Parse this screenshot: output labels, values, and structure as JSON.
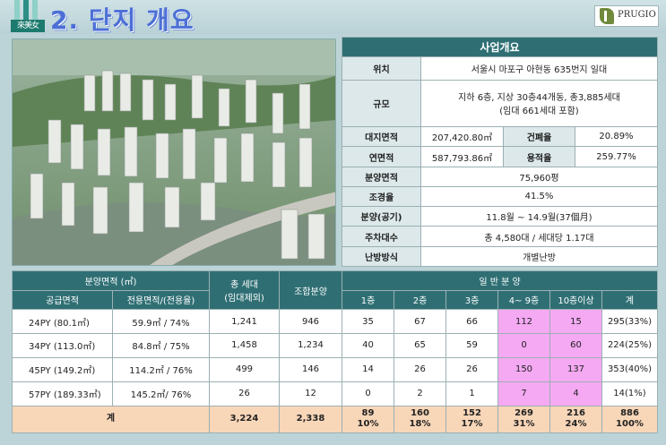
{
  "header": {
    "badge": "來美女",
    "title": "2. 단지 개요",
    "logo": "PRUGIO"
  },
  "info": {
    "heading": "사업개요",
    "rows": {
      "location": {
        "label": "위치",
        "value": "서울시 마포구 아현동 635번지 일대"
      },
      "scale": {
        "label": "규모",
        "line1": "지하 6층, 지상 30층44개동, 총3,885세대",
        "line2": "(임대 661세대 포함)"
      },
      "site": {
        "label": "대지면적",
        "value": "207,420.80㎡",
        "label2": "건폐율",
        "value2": "20.89%"
      },
      "floor": {
        "label": "연면적",
        "value": "587,793.86㎡",
        "label2": "용적율",
        "value2": "259.77%"
      },
      "sale_area": {
        "label": "분양면적",
        "value": "75,960평"
      },
      "landscape": {
        "label": "조경율",
        "value": "41.5%"
      },
      "schedule": {
        "label": "분양(공기)",
        "value": "11.8월 ~ 14.9월(37個月)"
      },
      "parking": {
        "label": "주차대수",
        "value": "총 4,580대 /  세대당 1.17대"
      },
      "heating": {
        "label": "난방방식",
        "value": "개별난방"
      }
    }
  },
  "table": {
    "h_area": "분양면적 (㎡)",
    "h_supply": "공급면적",
    "h_excl": "전용면적/(전용율)",
    "h_total_line1": "총 세대",
    "h_total_line2": "(임대제외)",
    "h_union": "조합분양",
    "h_general": "일 반 분 양",
    "h_floors": [
      "1층",
      "2층",
      "3층",
      "4~ 9층",
      "10층이상",
      "계"
    ],
    "rows": [
      {
        "supply": "24PY (80.1㎡)",
        "excl": "59.9㎡ / 74%",
        "total": "1,241",
        "union": "946",
        "f": [
          "35",
          "67",
          "66",
          "112",
          "15",
          "295(33%)"
        ]
      },
      {
        "supply": "34PY (113.0㎡)",
        "excl": "84.8㎡ / 75%",
        "total": "1,458",
        "union": "1,234",
        "f": [
          "40",
          "65",
          "59",
          "0",
          "60",
          "224(25%)"
        ]
      },
      {
        "supply": "45PY (149.2㎡)",
        "excl": "114.2㎡ / 76%",
        "total": "499",
        "union": "146",
        "f": [
          "14",
          "26",
          "26",
          "150",
          "137",
          "353(40%)"
        ]
      },
      {
        "supply": "57PY (189.33㎡)",
        "excl": "145.2㎡/ 76%",
        "total": "26",
        "union": "12",
        "f": [
          "0",
          "2",
          "1",
          "7",
          "4",
          "14(1%)"
        ]
      }
    ],
    "sum": {
      "label": "계",
      "total": "3,224",
      "union": "2,338",
      "f": [
        [
          "89",
          "10%"
        ],
        [
          "160",
          "18%"
        ],
        [
          "152",
          "17%"
        ],
        [
          "269",
          "31%"
        ],
        [
          "216",
          "24%"
        ],
        [
          "886",
          "100%"
        ]
      ]
    }
  },
  "colors": {
    "header_teal": "#2f6f74",
    "highlight_pink": "#f4a9f2",
    "total_row": "#f8d6b8"
  }
}
